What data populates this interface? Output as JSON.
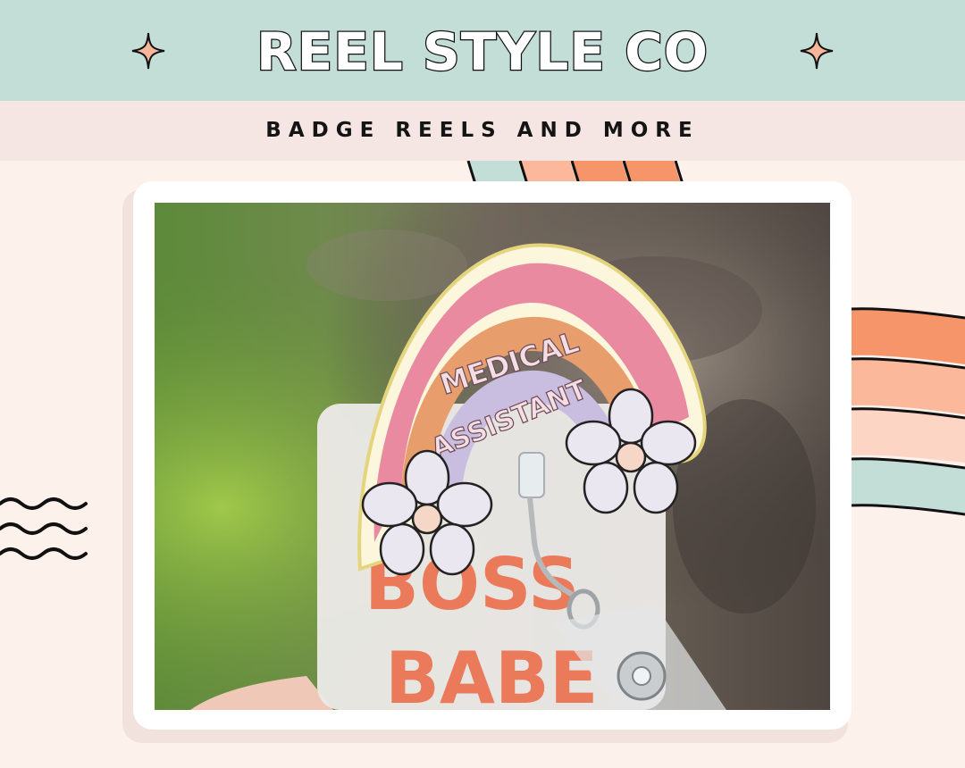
{
  "header": {
    "brand": "REEL STYLE CO",
    "tagline": "BADGE REELS AND MORE"
  },
  "photo": {
    "badge_text": [
      "MEDICAL",
      "ASSISTANT"
    ],
    "card_text": [
      "BOSS",
      "BABE"
    ]
  },
  "colors": {
    "header_bg": "#c3ddd7",
    "subheader_bg": "#f6e6e3",
    "page_bg": "#fdf1ec",
    "accent_orange": "#f7956a",
    "accent_peach": "#fbb89a",
    "accent_pink": "#e98aa1",
    "accent_teal": "#c3ddd7"
  },
  "icons": [
    "sparkle-icon",
    "wave-lines-icon",
    "rainbow-stripes-decoration"
  ]
}
